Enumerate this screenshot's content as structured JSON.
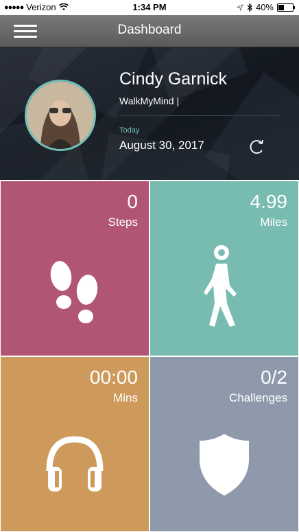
{
  "status_bar": {
    "carrier": "Verizon",
    "time": "1:34 PM",
    "battery": "40%",
    "battery_level": 0.4
  },
  "nav": {
    "title": "Dashboard",
    "menu_icon": "hamburger-icon"
  },
  "profile": {
    "name": "Cindy Garnick",
    "app": "WalkMyMind |",
    "date_label": "Today",
    "date": "August 30, 2017",
    "refresh_icon": "refresh-icon"
  },
  "tiles": [
    {
      "value": "0",
      "label": "Steps",
      "icon": "footprints-icon",
      "color": "#b15574"
    },
    {
      "value": "4.99",
      "label": "Miles",
      "icon": "walking-person-icon",
      "color": "#77bbb1"
    },
    {
      "value": "00:00",
      "label": "Mins",
      "icon": "headphones-icon",
      "color": "#cd9a5b"
    },
    {
      "value": "0/2",
      "label": "Challenges",
      "icon": "shield-icon",
      "color": "#8e9aab"
    }
  ]
}
